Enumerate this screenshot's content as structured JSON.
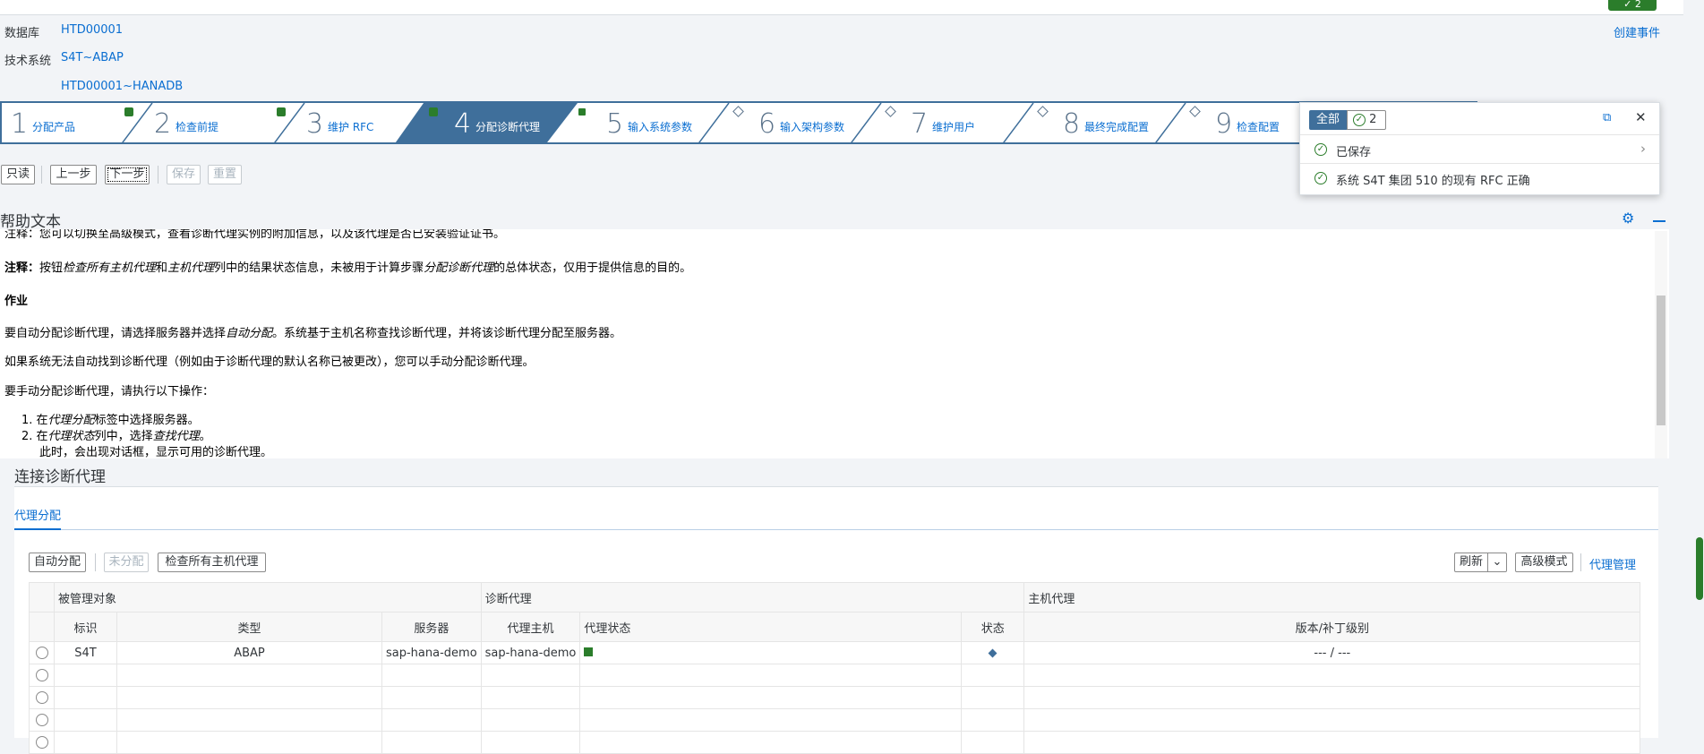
{
  "header": {
    "notification_count": "2",
    "database_label": "数据库",
    "database_value": "HTD00001",
    "tech_system_label": "技术系统",
    "tech_system_value": "S4T~ABAP",
    "tech_system_value2": "HTD00001~HANADB",
    "create_event": "创建事件"
  },
  "roadmap": {
    "steps": [
      {
        "num": "1",
        "label": "分配产品",
        "status": "done"
      },
      {
        "num": "2",
        "label": "检查前提",
        "status": "done"
      },
      {
        "num": "3",
        "label": "维护 RFC",
        "status": "done"
      },
      {
        "num": "4",
        "label": "分配诊断代理",
        "status": "active"
      },
      {
        "num": "5",
        "label": "输入系统参数",
        "status": "open"
      },
      {
        "num": "6",
        "label": "输入架构参数",
        "status": "open"
      },
      {
        "num": "7",
        "label": "维护用户",
        "status": "open"
      },
      {
        "num": "8",
        "label": "最终完成配置",
        "status": "open"
      },
      {
        "num": "9",
        "label": "检查配置",
        "status": "open"
      }
    ]
  },
  "toolbar": {
    "readonly": "只读",
    "prev": "上一步",
    "next": "下一步",
    "save": "保存",
    "reset": "重置"
  },
  "help": {
    "title": "帮助文本",
    "line0": "注释：您可以切换至高级模式，查看诊断代理实例的附加信息，以及该代理是否已安装验证证书。",
    "line1_bold": "注释：",
    "line1_a": "按钮",
    "line1_i1": "检查所有主机代理",
    "line1_b": "和",
    "line1_i2": "主机代理",
    "line1_c": "列中的结果状态信息，未被用于计算步骤",
    "line1_i3": "分配诊断代理",
    "line1_d": "的总体状态，仅用于提供信息的目的。",
    "task_heading": "作业",
    "line2_a": "要自动分配诊断代理，请选择服务器并选择",
    "line2_i": "自动分配",
    "line2_b": "。系统基于主机名称查找诊断代理，并将该诊断代理分配至服务器。",
    "line3": "如果系统无法自动找到诊断代理（例如由于诊断代理的默认名称已被更改），您可以手动分配诊断代理。",
    "line4": "要手动分配诊断代理，请执行以下操作：",
    "li1_a": "1. 在",
    "li1_i": "代理分配",
    "li1_b": "标签中选择服务器。",
    "li2_a": "2. 在",
    "li2_i1": "代理状态",
    "li2_b": "列中，选择",
    "li2_i2": "查找代理",
    "li2_c": "。",
    "li2_d": "此时，会出现对话框，显示可用的诊断代理。"
  },
  "connect": {
    "title": "连接诊断代理",
    "tab": "代理分配",
    "auto_assign": "自动分配",
    "unassign": "未分配",
    "check_all": "检查所有主机代理",
    "refresh": "刷新",
    "advanced": "高级模式",
    "agent_admin": "代理管理"
  },
  "table": {
    "group1": "被管理对象",
    "group2": "诊断代理",
    "group3": "主机代理",
    "col_id": "标识",
    "col_type": "类型",
    "col_server": "服务器",
    "col_agent_host": "代理主机",
    "col_agent_status": "代理状态",
    "col_status": "状态",
    "col_version": "版本/补丁级别",
    "rows": [
      {
        "id": "S4T",
        "type": "ABAP",
        "server": "sap-hana-demo",
        "agent_host": "sap-hana-demo",
        "version": "--- / ---"
      }
    ]
  },
  "popover": {
    "all": "全部",
    "count": "2",
    "msg1": "已保存",
    "msg2": "系统 S4T 集团 510 的现有 RFC 正确"
  },
  "colors": {
    "accent": "#0a6ed1",
    "active_step": "#3f6f9b",
    "success": "#2b7d2b"
  }
}
